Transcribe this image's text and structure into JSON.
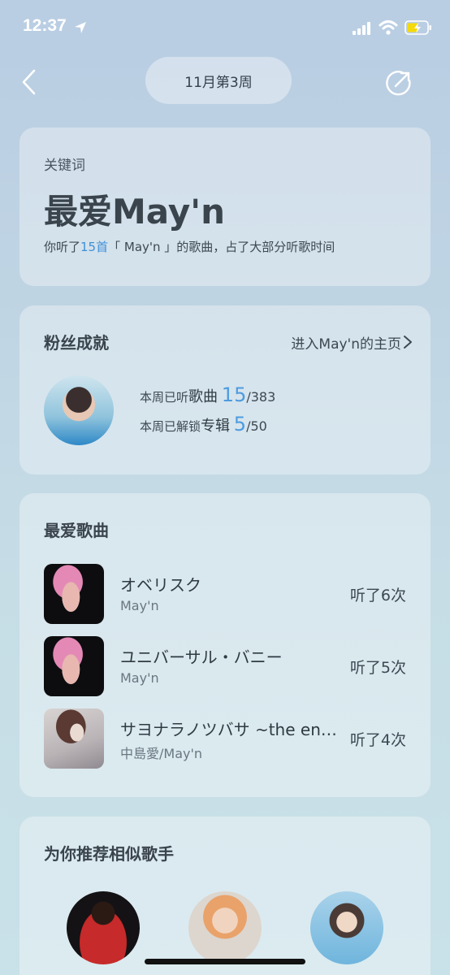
{
  "status_bar": {
    "time": "12:37"
  },
  "header": {
    "week_label": "11月第3周"
  },
  "keyword_card": {
    "label": "关键词",
    "title": "最爱May'n",
    "desc_prefix": "你听了",
    "desc_count": "15首",
    "desc_suffix": "「 May'n 」的歌曲，占了大部分听歌时间"
  },
  "fan_card": {
    "title": "粉丝成就",
    "link": "进入May'n的主页",
    "songs_prefix": "本周已听",
    "songs_word": "歌曲",
    "songs_num": "15",
    "songs_total": "/383",
    "albums_prefix": "本周已解锁",
    "albums_word": "专辑",
    "albums_num": "5",
    "albums_total": "/50"
  },
  "songs_card": {
    "title": "最爱歌曲",
    "items": [
      {
        "title": "オベリスク",
        "artist": "May'n",
        "count": "听了6次"
      },
      {
        "title": "ユニバーサル・バニー",
        "artist": "May'n",
        "count": "听了5次"
      },
      {
        "title": "サヨナラノツバサ ~the end...",
        "artist": "中島愛/May'n",
        "count": "听了4次"
      }
    ]
  },
  "rec_card": {
    "title": "为你推荐相似歌手"
  },
  "colors": {
    "accent": "#4d9be0",
    "highlight": "#3f8fd6"
  }
}
